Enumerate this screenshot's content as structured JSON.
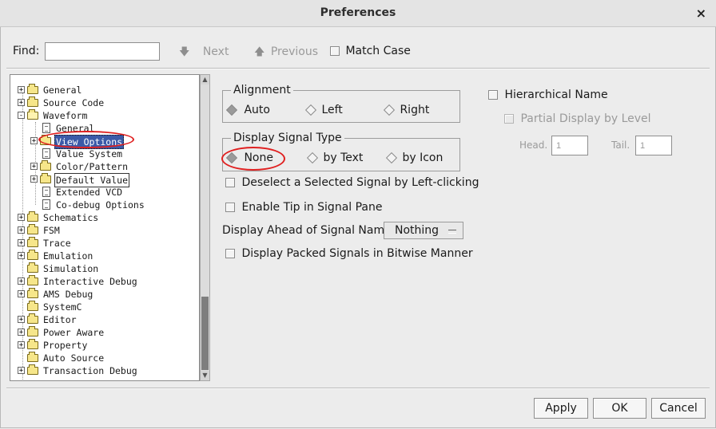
{
  "window": {
    "title": "Preferences",
    "close_glyph": "×"
  },
  "find": {
    "label": "Find:",
    "value": "",
    "next_label": "Next",
    "previous_label": "Previous",
    "match_case_label": "Match Case"
  },
  "tree": {
    "items": [
      {
        "label": "General",
        "expander": "+",
        "icon": "folder-icon"
      },
      {
        "label": "Source Code",
        "expander": "+",
        "icon": "folder-icon"
      },
      {
        "label": "Waveform",
        "expander": "-",
        "icon": "folder-open-icon"
      },
      {
        "label": "General",
        "icon": "document-icon"
      },
      {
        "label": "View Options",
        "expander": "+",
        "icon": "folder-icon",
        "selected": true
      },
      {
        "label": "Value System",
        "icon": "document-icon"
      },
      {
        "label": "Color/Pattern",
        "expander": "+",
        "icon": "folder-icon"
      },
      {
        "label": "Default Value",
        "expander": "+",
        "icon": "folder-icon"
      },
      {
        "label": "Extended VCD",
        "icon": "document-icon"
      },
      {
        "label": "Co-debug Options",
        "icon": "document-icon"
      },
      {
        "label": "Schematics",
        "expander": "+",
        "icon": "folder-icon"
      },
      {
        "label": "FSM",
        "expander": "+",
        "icon": "folder-icon"
      },
      {
        "label": "Trace",
        "expander": "+",
        "icon": "folder-icon"
      },
      {
        "label": "Emulation",
        "expander": "+",
        "icon": "folder-icon"
      },
      {
        "label": "Simulation",
        "icon": "folder-icon"
      },
      {
        "label": "Interactive Debug",
        "expander": "+",
        "icon": "folder-icon"
      },
      {
        "label": "AMS Debug",
        "expander": "+",
        "icon": "folder-icon"
      },
      {
        "label": "SystemC",
        "icon": "folder-icon"
      },
      {
        "label": "Editor",
        "expander": "+",
        "icon": "folder-icon"
      },
      {
        "label": "Power Aware",
        "expander": "+",
        "icon": "folder-icon"
      },
      {
        "label": "Property",
        "expander": "+",
        "icon": "folder-icon"
      },
      {
        "label": "Auto Source",
        "icon": "folder-icon"
      },
      {
        "label": "Transaction Debug",
        "expander": "+",
        "icon": "folder-icon"
      }
    ]
  },
  "alignment": {
    "title": "Alignment",
    "options": [
      "Auto",
      "Left",
      "Right"
    ],
    "selected": "Auto"
  },
  "display_signal_type": {
    "title": "Display Signal Type",
    "options": [
      "None",
      "by Text",
      "by Icon"
    ],
    "selected": "None"
  },
  "options": {
    "deselect_label": "Deselect a Selected Signal by Left-clicking",
    "enable_tip_label": "Enable Tip in Signal Pane",
    "display_ahead_label": "Display Ahead of Signal Name:",
    "display_ahead_value": "Nothing",
    "display_packed_label": "Display Packed Signals in Bitwise Manner"
  },
  "hierarchical": {
    "label": "Hierarchical Name",
    "partial_label": "Partial Display by Level",
    "head_label": "Head.",
    "head_value": "1",
    "tail_label": "Tail.",
    "tail_value": "1"
  },
  "buttons": {
    "apply": "Apply",
    "ok": "OK",
    "cancel": "Cancel"
  },
  "colors": {
    "selection": "#3b5aa8",
    "annotation": "#e02020"
  }
}
